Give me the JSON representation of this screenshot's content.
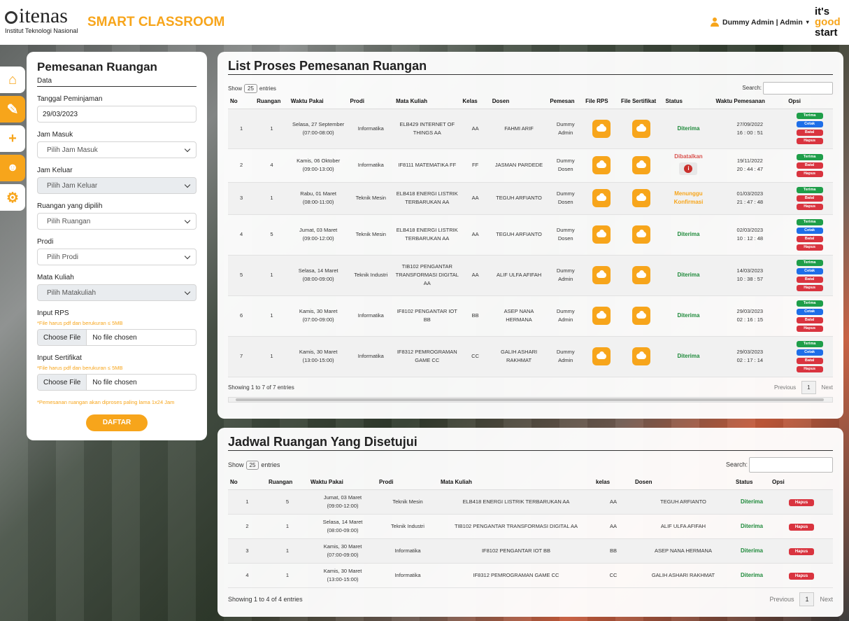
{
  "header": {
    "logo_name": "itenas",
    "logo_sub": "Institut Teknologi Nasional",
    "app_title": "SMART CLASSROOM",
    "user_label": "Dummy Admin | Admin",
    "slogan": [
      "it's",
      "good",
      "start"
    ]
  },
  "sidebar": {
    "items": [
      "home-icon",
      "edit-icon",
      "plus-icon",
      "user-lock-icon",
      "gear-icon"
    ]
  },
  "form": {
    "title": "Pemesanan Ruangan",
    "tab": "Data",
    "tanggal_label": "Tanggal Peminjaman",
    "tanggal_value": "29/03/2023",
    "jam_masuk_label": "Jam Masuk",
    "jam_masuk_value": "Pilih Jam Masuk",
    "jam_keluar_label": "Jam Keluar",
    "jam_keluar_value": "Pilih Jam Keluar",
    "ruangan_label": "Ruangan yang dipilih",
    "ruangan_value": "Pilih Ruangan",
    "prodi_label": "Prodi",
    "prodi_value": "Pilih Prodi",
    "matkul_label": "Mata Kuliah",
    "matkul_value": "Pilih Matakuliah",
    "rps_label": "Input RPS",
    "rps_hint": "*File harus pdf dan berukuran ≤ 5MB",
    "sert_label": "Input Sertifikat",
    "sert_hint": "*File harus pdf dan berukuran ≤ 5MB",
    "choose_file": "Choose File",
    "no_file": "No file chosen",
    "note": "*Pemesanan ruangan akan diproses paling lama 1x24 Jam",
    "submit": "DAFTAR"
  },
  "list": {
    "title": "List Proses Pemesanan Ruangan",
    "show": "Show",
    "length": "25",
    "entries": "entries",
    "search": "Search:",
    "columns": [
      "No",
      "Ruangan",
      "Waktu Pakai",
      "Prodi",
      "Mata Kuliah",
      "Kelas",
      "Dosen",
      "Pemesan",
      "File RPS",
      "File Sertifikat",
      "Status",
      "Waktu Pemesanan",
      "Opsi"
    ],
    "rows": [
      {
        "no": "1",
        "ruangan": "1",
        "waktu1": "Selasa, 27 September",
        "waktu2": "(07:00-08:00)",
        "prodi": "Informatika",
        "matkul": "ELB429 INTERNET OF THINGS AA",
        "kelas": "AA",
        "dosen": "FAHMI ARIF",
        "pemesan": "Dummy Admin",
        "status": "Diterima",
        "pesan1": "27/09/2022",
        "pesan2": "16 : 00 : 51"
      },
      {
        "no": "2",
        "ruangan": "4",
        "waktu1": "Kamis, 06 Oktober",
        "waktu2": "(09:00-13:00)",
        "prodi": "Informatika",
        "matkul": "IF8111 MATEMATIKA FF",
        "kelas": "FF",
        "dosen": "JASMAN PARDEDE",
        "pemesan": "Dummy Dosen",
        "status": "Dibatalkan",
        "pesan1": "19/11/2022",
        "pesan2": "20 : 44 : 47"
      },
      {
        "no": "3",
        "ruangan": "1",
        "waktu1": "Rabu, 01 Maret",
        "waktu2": "(08:00-11:00)",
        "prodi": "Teknik Mesin",
        "matkul": "ELB418 ENERGI LISTRIK TERBARUKAN AA",
        "kelas": "AA",
        "dosen": "TEGUH ARFIANTO",
        "pemesan": "Dummy Dosen",
        "status": "Menunggu Konfirmasi",
        "pesan1": "01/03/2023",
        "pesan2": "21 : 47 : 48"
      },
      {
        "no": "4",
        "ruangan": "5",
        "waktu1": "Jumat, 03 Maret",
        "waktu2": "(09:00-12:00)",
        "prodi": "Teknik Mesin",
        "matkul": "ELB418 ENERGI LISTRIK TERBARUKAN AA",
        "kelas": "AA",
        "dosen": "TEGUH ARFIANTO",
        "pemesan": "Dummy Dosen",
        "status": "Diterima",
        "pesan1": "02/03/2023",
        "pesan2": "10 : 12 : 48"
      },
      {
        "no": "5",
        "ruangan": "1",
        "waktu1": "Selasa, 14 Maret",
        "waktu2": "(08:00-09:00)",
        "prodi": "Teknik Industri",
        "matkul": "TIB102 PENGANTAR TRANSFORMASI DIGITAL AA",
        "kelas": "AA",
        "dosen": "ALIF ULFA AFIFAH",
        "pemesan": "Dummy Admin",
        "status": "Diterima",
        "pesan1": "14/03/2023",
        "pesan2": "10 : 38 : 57"
      },
      {
        "no": "6",
        "ruangan": "1",
        "waktu1": "Kamis, 30 Maret",
        "waktu2": "(07:00-09:00)",
        "prodi": "Informatika",
        "matkul": "IF8102 PENGANTAR IOT BB",
        "kelas": "BB",
        "dosen": "ASEP NANA HERMANA",
        "pemesan": "Dummy Admin",
        "status": "Diterima",
        "pesan1": "29/03/2023",
        "pesan2": "02 : 16 : 15"
      },
      {
        "no": "7",
        "ruangan": "1",
        "waktu1": "Kamis, 30 Maret",
        "waktu2": "(13:00-15:00)",
        "prodi": "Informatika",
        "matkul": "IF8312 PEMROGRAMAN GAME CC",
        "kelas": "CC",
        "dosen": "GALIH ASHARI RAKHMAT",
        "pemesan": "Dummy Admin",
        "status": "Diterima",
        "pesan1": "29/03/2023",
        "pesan2": "02 : 17 : 14"
      }
    ],
    "opsi": {
      "terima": "Terima",
      "cetak": "Cetak",
      "batal": "Batal",
      "hapus": "Hapus"
    },
    "info": "Showing 1 to 7 of 7 entries",
    "prev": "Previous",
    "page": "1",
    "next": "Next"
  },
  "jadwal": {
    "title": "Jadwal Ruangan Yang Disetujui",
    "show": "Show",
    "length": "25",
    "entries": "entries",
    "search": "Search:",
    "columns": [
      "No",
      "Ruangan",
      "Waktu Pakai",
      "Prodi",
      "Mata Kuliah",
      "kelas",
      "Dosen",
      "Status",
      "Opsi"
    ],
    "rows": [
      {
        "no": "1",
        "ruangan": "5",
        "waktu1": "Jumat, 03 Maret",
        "waktu2": "(09:00-12:00)",
        "prodi": "Teknik Mesin",
        "matkul": "ELB418 ENERGI LISTRIK TERBARUKAN AA",
        "kelas": "AA",
        "dosen": "TEGUH ARFIANTO",
        "status": "Diterima"
      },
      {
        "no": "2",
        "ruangan": "1",
        "waktu1": "Selasa, 14 Maret",
        "waktu2": "(08:00-09:00)",
        "prodi": "Teknik Industri",
        "matkul": "TIB102 PENGANTAR TRANSFORMASI DIGITAL AA",
        "kelas": "AA",
        "dosen": "ALIF ULFA AFIFAH",
        "status": "Diterima"
      },
      {
        "no": "3",
        "ruangan": "1",
        "waktu1": "Kamis, 30 Maret",
        "waktu2": "(07:00-09:00)",
        "prodi": "Informatika",
        "matkul": "IF8102 PENGANTAR IOT BB",
        "kelas": "BB",
        "dosen": "ASEP NANA HERMANA",
        "status": "Diterima"
      },
      {
        "no": "4",
        "ruangan": "1",
        "waktu1": "Kamis, 30 Maret",
        "waktu2": "(13:00-15:00)",
        "prodi": "Informatika",
        "matkul": "IF8312 PEMROGRAMAN GAME CC",
        "kelas": "CC",
        "dosen": "GALIH ASHARI RAKHMAT",
        "status": "Diterima"
      }
    ],
    "hapus": "Hapus",
    "info": "Showing 1 to 4 of 4 entries",
    "prev": "Previous",
    "page": "1",
    "next": "Next"
  }
}
